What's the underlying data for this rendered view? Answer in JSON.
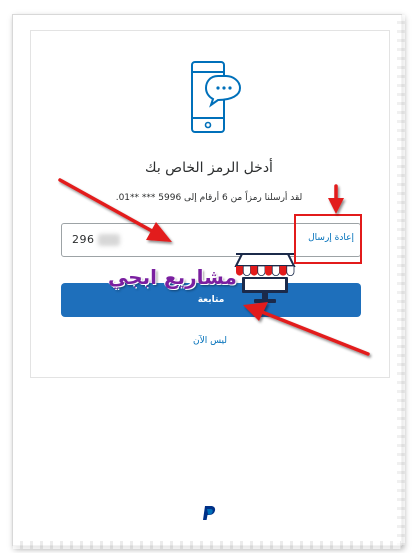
{
  "verification": {
    "title": "أدخل الرمز الخاص بك",
    "subtitle": "لقد أرسلنا رمزاً من 6 أرقام إلى 5996 *** **01.",
    "code_value": "296",
    "resend_label": "إعادة إرسال",
    "continue_label": "متابعة",
    "not_now_label": "ليس الآن"
  },
  "watermark": {
    "text": "مشاريع ابجي"
  },
  "icons": {
    "phone": "phone-chat-icon",
    "logo": "paypal-logo",
    "store": "storefront-icon"
  },
  "colors": {
    "accent": "#0070ba",
    "button": "#1e6fbb",
    "annotation": "#e21b1b",
    "watermark": "#7a1fa0"
  }
}
